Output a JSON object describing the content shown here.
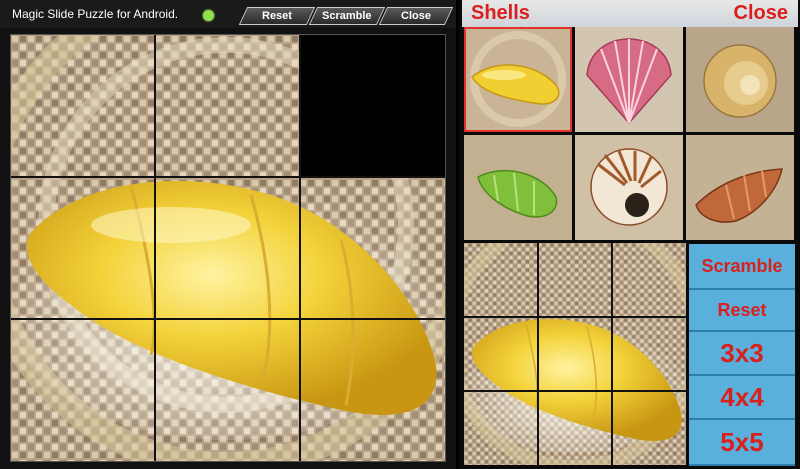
{
  "app": {
    "title": "Magic Slide Puzzle for Android.",
    "status_color": "#8fe04a",
    "toolbar": {
      "reset_label": "Reset",
      "scramble_label": "Scramble",
      "close_label": "Close"
    }
  },
  "puzzle": {
    "grid_size": "3x3",
    "empty_position": {
      "row": 1,
      "col": 3
    },
    "image": "yellow-shell"
  },
  "side_panel": {
    "title": "Shells",
    "close_label": "Close",
    "images": [
      {
        "name": "yellow-shell",
        "selected": true
      },
      {
        "name": "pink-scallop-shell",
        "selected": false
      },
      {
        "name": "moon-shell",
        "selected": false
      },
      {
        "name": "green-snail-shell",
        "selected": false
      },
      {
        "name": "nautilus-shell",
        "selected": false
      },
      {
        "name": "conch-shell",
        "selected": false
      }
    ],
    "buttons": {
      "scramble": "Scramble",
      "reset": "Reset",
      "size_3": "3x3",
      "size_4": "4x4",
      "size_5": "5x5"
    }
  },
  "colors": {
    "accent_red": "#d9201c",
    "button_blue": "#5ab0dc"
  }
}
